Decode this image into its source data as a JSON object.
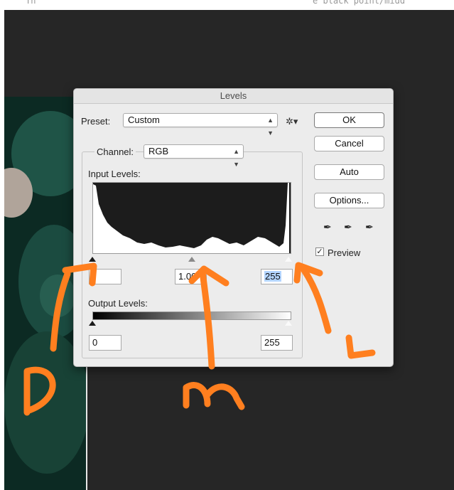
{
  "top_strip": {
    "left_text": "Th",
    "right_text": "e black point/midd"
  },
  "dialog": {
    "title": "Levels",
    "preset_label": "Preset:",
    "preset_value": "Custom",
    "buttons": {
      "ok": "OK",
      "cancel": "Cancel",
      "auto": "Auto",
      "options": "Options..."
    },
    "channel_label": "Channel:",
    "channel_value": "RGB",
    "input_levels_label": "Input Levels:",
    "input": {
      "black": "",
      "mid": "1.00",
      "white": "255"
    },
    "output_levels_label": "Output Levels:",
    "output": {
      "black": "0",
      "white": "255"
    },
    "preview_label": "Preview",
    "preview_checked": true,
    "icons": [
      "gear-icon",
      "black-eyedropper-icon",
      "gray-eyedropper-icon",
      "white-eyedropper-icon"
    ]
  },
  "annotations": {
    "color": "#ff7f1f",
    "letters": [
      "D",
      "m",
      "L"
    ]
  },
  "colors": {
    "canvas": "#262626",
    "dialog_bg": "#ececec",
    "photo": "#0c2a23",
    "selection": "#b4d5ff"
  }
}
